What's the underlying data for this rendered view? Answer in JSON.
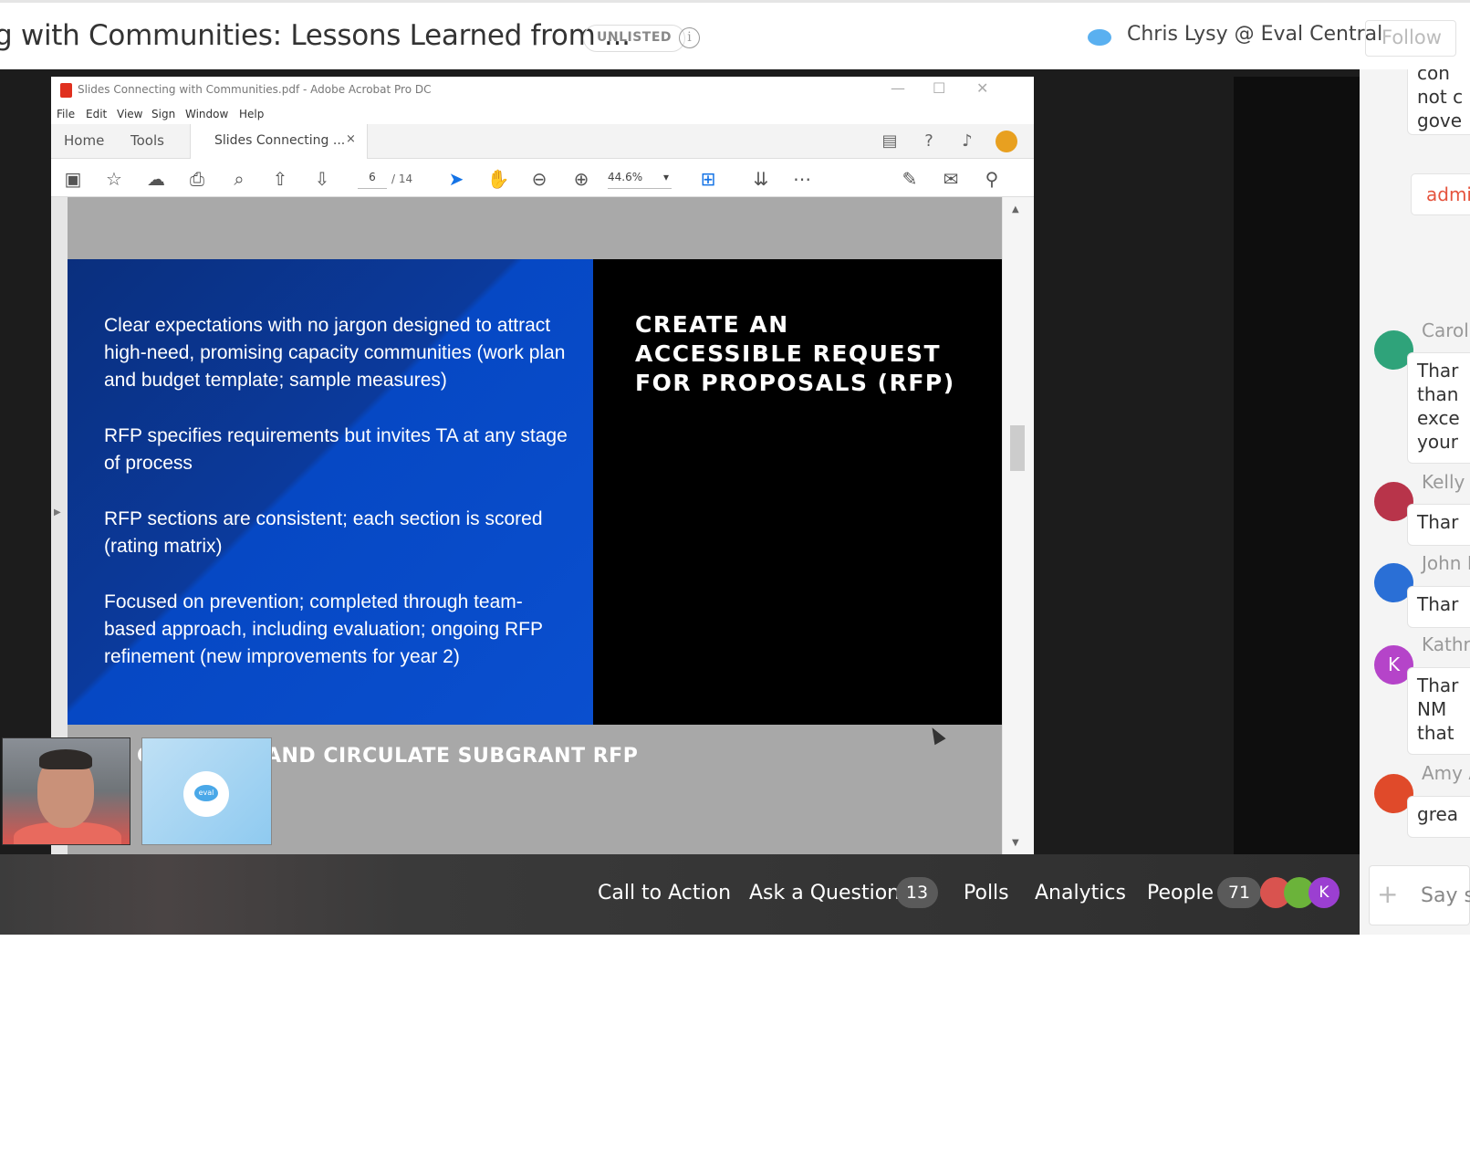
{
  "header": {
    "title": "g with Communities: Lessons Learned from ...",
    "visibility_badge": "UNLISTED",
    "info_icon": "i",
    "host_name": "Chris Lysy @ Eval Central",
    "follow_label": "Follow"
  },
  "acrobat": {
    "window_title": "Slides Connecting with Communities.pdf - Adobe Acrobat Pro DC",
    "menu": [
      "File",
      "Edit",
      "View",
      "Sign",
      "Window",
      "Help"
    ],
    "tabs": {
      "home": "Home",
      "tools": "Tools",
      "document": "Slides Connecting ...",
      "close": "×"
    },
    "page_current": "6",
    "page_total": "/ 14",
    "zoom": "44.6%",
    "zoom_caret": "▾"
  },
  "slide": {
    "bullets": [
      "Clear expectations with no jargon designed to attract high-need, promising capacity communities (work plan and budget template; sample measures)",
      "RFP specifies requirements but invites TA at any stage of process",
      "RFP sections are consistent; each section is scored (rating matrix)",
      "Focused on prevention; completed through team-based approach, including evaluation; ongoing RFP refinement (new improvements for year 2)"
    ],
    "heading_lines": [
      "CREATE AN",
      "ACCESSIBLE REQUEST",
      "FOR PROPOSALS (RFP)"
    ],
    "next_slide_title": "GENERATE AND CIRCULATE SUBGRANT RFP"
  },
  "bottom_bar": {
    "call_to_action": "Call to Action",
    "ask_question": "Ask a Question",
    "question_count": "13",
    "polls": "Polls",
    "analytics": "Analytics",
    "people": "People",
    "people_count": "71",
    "avatar_initial": "K"
  },
  "chat": {
    "top_message": "con\nnot c\ngove",
    "admin_label": "admin",
    "messages": [
      {
        "name": "Caroli",
        "text": "Thar\nthan\nexce\nyour",
        "avatar_color": "#2fa37a"
      },
      {
        "name": "Kelly C",
        "text": "Thar",
        "avatar_color": "#b8344a"
      },
      {
        "name": "John E",
        "text": "Thar",
        "avatar_color": "#2a6fd6"
      },
      {
        "name": "Kathr",
        "text": "Thar\nNM\nthat",
        "avatar_color": "#b544c9",
        "initial": "K"
      },
      {
        "name": "Amy A",
        "text": "grea",
        "avatar_color": "#e04a2a"
      }
    ],
    "input_plus": "+",
    "input_placeholder": "Say so"
  },
  "colors": {
    "brand_blue": "#1473e6",
    "slide_blue": "#0a4fcf",
    "admin_red": "#e5533d"
  }
}
